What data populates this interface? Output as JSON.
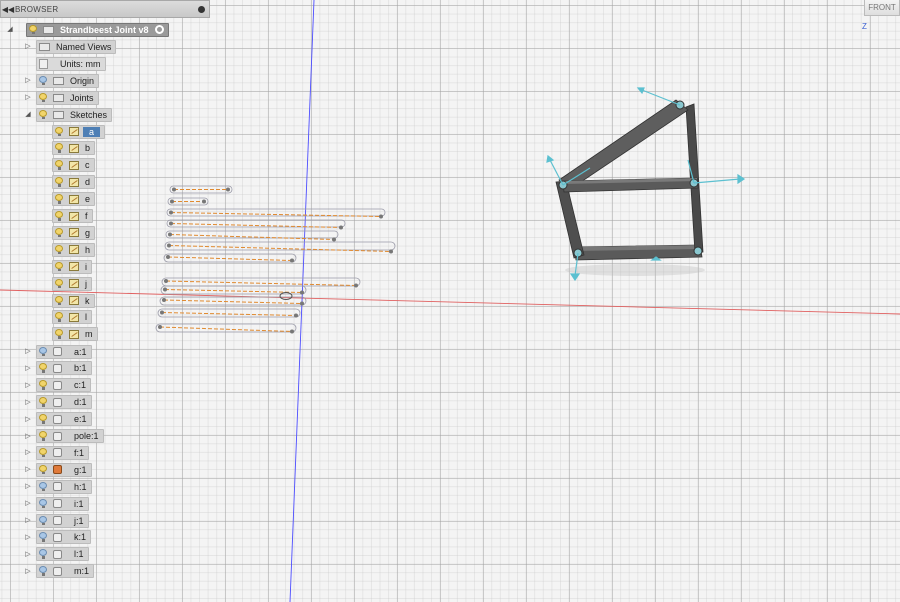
{
  "browser": {
    "title": "BROWSER",
    "root_label": "Strandbeest Joint v8",
    "named_views_label": "Named Views",
    "units_label": "Units: mm",
    "origin_label": "Origin",
    "joints_label": "Joints",
    "sketches_label": "Sketches",
    "sketches": [
      "a",
      "b",
      "c",
      "d",
      "e",
      "f",
      "g",
      "h",
      "i",
      "j",
      "k",
      "l",
      "m"
    ],
    "selected_sketch": "a",
    "components": [
      {
        "label": "a:1",
        "bulb": "blue"
      },
      {
        "label": "b:1",
        "bulb": "on"
      },
      {
        "label": "c:1",
        "bulb": "on"
      },
      {
        "label": "d:1",
        "bulb": "on"
      },
      {
        "label": "e:1",
        "bulb": "on"
      },
      {
        "label": "pole:1",
        "bulb": "on"
      },
      {
        "label": "f:1",
        "bulb": "on"
      },
      {
        "label": "g:1",
        "bulb": "on",
        "icon": "orange"
      },
      {
        "label": "h:1",
        "bulb": "blue"
      },
      {
        "label": "i:1",
        "bulb": "blue"
      },
      {
        "label": "j:1",
        "bulb": "blue"
      },
      {
        "label": "k:1",
        "bulb": "blue"
      },
      {
        "label": "l:1",
        "bulb": "blue"
      },
      {
        "label": "m:1",
        "bulb": "blue"
      }
    ]
  },
  "viewcube": {
    "face_label": "FRONT",
    "axis_label": "Z"
  },
  "colors": {
    "selection": "#4e7fb5",
    "x_axis": "#e06060",
    "y_axis": "#4d4dff",
    "link_body": "#505050",
    "sketch_line": "#e08a30",
    "joint_marker": "#5cc0d0"
  }
}
